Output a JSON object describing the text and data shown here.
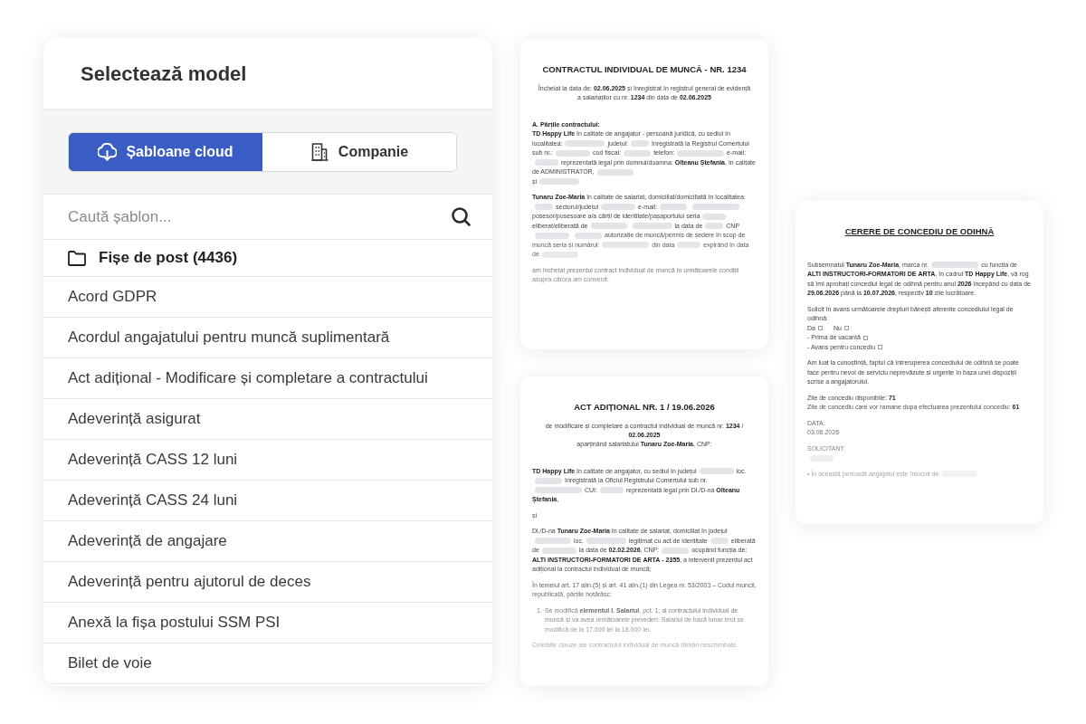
{
  "panel": {
    "title": "Selectează model",
    "tabs": [
      {
        "label": "Șabloane cloud",
        "selected": true
      },
      {
        "label": "Companie",
        "selected": false
      }
    ],
    "search": {
      "placeholder": "Caută șablon..."
    },
    "folder": {
      "label": "Fișe de post (4436)"
    },
    "templates": [
      "Acord GDPR",
      "Acordul angajatului pentru muncă suplimentară",
      "Act adițional - Modificare și completare a contractului",
      "Adeverință asigurat",
      "Adeverință CASS 12 luni",
      "Adeverință CASS 24 luni",
      "Adeverință de angajare",
      "Adeverință pentru ajutorul de deces",
      "Anexă la fișa postului SSM PSI",
      "Bilet de voie"
    ]
  },
  "documents": [
    {
      "title": "CONTRACTUL INDIVIDUAL DE MUNCĂ - NR. 1234",
      "title_underlined": false,
      "blocks": [
        {
          "kind": "centered",
          "lines": [
            [
              {
                "kind": "text",
                "text": "Încheiat la data de: **02.06.2025** și înregistrat în registrul general de evidență"
              }
            ],
            [
              {
                "kind": "text",
                "text": "a salariaților cu nr. **1234** din data de **02.06.2025**"
              }
            ]
          ]
        },
        {
          "kind": "plain",
          "lines": [
            [
              {
                "kind": "text",
                "text": "**A. Părțile contractului:**"
              }
            ],
            [
              {
                "kind": "text",
                "text": "**TD Happy Life** în calitate de angajator - persoană juridică, cu sediul în localitatea:"
              },
              {
                "kind": "blank"
              },
              {
                "kind": "text",
                "text": "județul:"
              },
              {
                "kind": "blank"
              },
              {
                "kind": "text",
                "text": "înregistrată la Registrul Comerțului sub nr.:"
              },
              {
                "kind": "blank"
              },
              {
                "kind": "text",
                "text": "cod fiscal:"
              },
              {
                "kind": "blank"
              },
              {
                "kind": "text",
                "text": "telefon:"
              },
              {
                "kind": "blank"
              },
              {
                "kind": "text",
                "text": "e-mail:"
              },
              {
                "kind": "blank"
              },
              {
                "kind": "text",
                "text": "reprezentată legal prin domnul/doamna: **Olteanu Ștefania**, în calitate de ADMINISTRATOR,"
              },
              {
                "kind": "blank"
              }
            ],
            [
              {
                "kind": "text",
                "text": "și"
              },
              {
                "kind": "blank"
              }
            ]
          ]
        },
        {
          "kind": "plain",
          "lines": [
            [
              {
                "kind": "text",
                "text": "**Tunaru Zoe-Maria** în calitate de salariat, domiciliat/domiciliată în localitatea:"
              },
              {
                "kind": "blank"
              },
              {
                "kind": "text",
                "text": "sectorul/județul"
              },
              {
                "kind": "blank"
              },
              {
                "kind": "text",
                "text": "e-mail:"
              },
              {
                "kind": "blank"
              },
              {
                "kind": "blank"
              },
              {
                "kind": "text",
                "text": "posesor/posesoare a/a cărții de identitate/pașaportului seria"
              },
              {
                "kind": "blank"
              },
              {
                "kind": "text",
                "text": "eliberat/eliberată de"
              },
              {
                "kind": "blank"
              },
              {
                "kind": "blank"
              },
              {
                "kind": "text",
                "text": "la data de"
              },
              {
                "kind": "blank"
              },
              {
                "kind": "text",
                "text": "CNP"
              },
              {
                "kind": "blank"
              },
              {
                "kind": "blank"
              },
              {
                "kind": "text",
                "text": "autorizație de muncă/permis de ședere în scop de muncă seria și numărul:"
              },
              {
                "kind": "blank"
              },
              {
                "kind": "text",
                "text": "din data"
              },
              {
                "kind": "blank"
              },
              {
                "kind": "text",
                "text": "expirând în data de"
              },
              {
                "kind": "blank"
              }
            ]
          ]
        },
        {
          "kind": "plain",
          "lines": [
            [
              {
                "kind": "text",
                "text": "am încheiat prezentul contract individual de muncă în următoarele condiții asupra cărora am convenit:"
              }
            ]
          ]
        }
      ]
    },
    {
      "title": "ACT ADIȚIONAL NR. 1 / 19.06.2026",
      "title_underlined": false,
      "blocks": [
        {
          "kind": "centered",
          "lines": [
            [
              {
                "kind": "text",
                "text": "de modificare și completare a contractul individual de muncă nr. **1234** / **02.06.2025**"
              }
            ],
            [
              {
                "kind": "text",
                "text": "aparținând salariatului **Tunaru Zoe-Maria**, CNP:"
              }
            ]
          ]
        },
        {
          "kind": "plain",
          "lines": [
            [
              {
                "kind": "text",
                "text": "**TD Happy Life** în calitate de angajator, cu sediul în județul"
              },
              {
                "kind": "blank"
              },
              {
                "kind": "text",
                "text": "loc."
              },
              {
                "kind": "blank"
              },
              {
                "kind": "text",
                "text": "înregistrată la Oficiul Registrului Comerțului sub nr."
              },
              {
                "kind": "blank"
              },
              {
                "kind": "text",
                "text": "CUI:"
              },
              {
                "kind": "blank"
              },
              {
                "kind": "text",
                "text": "reprezentată legal prin Dl./D-na **Olteanu Ștefania**,"
              }
            ]
          ]
        },
        {
          "kind": "plain",
          "lines": [
            [
              {
                "kind": "text",
                "text": "și"
              }
            ]
          ]
        },
        {
          "kind": "plain",
          "lines": [
            [
              {
                "kind": "text",
                "text": "Dl./D-na **Tunaru Zoe-Maria** în calitate de salariat, domiciliat în județul"
              },
              {
                "kind": "blank"
              },
              {
                "kind": "text",
                "text": "loc."
              },
              {
                "kind": "blank"
              },
              {
                "kind": "text",
                "text": "legitimat cu act de identitate"
              },
              {
                "kind": "blank"
              },
              {
                "kind": "text",
                "text": "eliberată de"
              },
              {
                "kind": "blank"
              },
              {
                "kind": "text",
                "text": "la data de **02.02.2026**, CNP:"
              },
              {
                "kind": "blank"
              },
              {
                "kind": "text",
                "text": "ocupând funcția de: **ALTI INSTRUCTORI-FORMATORI DE ARTA - 2355**, a intervenit prezentul act adițional la contractul individual de muncă;"
              }
            ]
          ]
        },
        {
          "kind": "plain",
          "lines": [
            [
              {
                "kind": "text",
                "text": "În temeiul art. 17 alin.(5) și art. 41 alin.(1) din Legea nr. 53/2003 – Codul muncii, republicată, părțile hotărăsc:"
              }
            ]
          ]
        },
        {
          "kind": "numbered",
          "number": "1.",
          "lines": [
            [
              {
                "kind": "text",
                "text": "Se modifică **elementul I. Salariul**, pct. 1; al contractului individual de muncă și va avea următoarele prevederi: Salariul de bază lunar brut se modifică de la 17.000 lei la 18.000 lei."
              }
            ]
          ]
        },
        {
          "kind": "plain",
          "lines": [
            [
              {
                "kind": "text",
                "text": "Celelalte clauze ale contractului individual de muncă rămân neschimbate."
              }
            ]
          ]
        }
      ]
    },
    {
      "title": "CERERE DE CONCEDIU DE ODIHNĂ",
      "title_underlined": true,
      "blocks": [
        {
          "kind": "plain",
          "lines": [
            [
              {
                "kind": "text",
                "text": "Subsemnatul **Tunaru Zoe-Maria**, marca nr."
              },
              {
                "kind": "blank"
              },
              {
                "kind": "text",
                "text": "cu funcția de **ALTI INSTRUCTORI-FORMATORI DE ARTA**, în cadrul **TD Happy Life**, vă rog să îmi aprobați concediul legal de odihnă pentru anul **2026** începând cu data de **29.06.2026** până la **10.07.2026**, respectiv **10** zile lucrătoare."
              }
            ]
          ]
        },
        {
          "kind": "plain",
          "lines": [
            [
              {
                "kind": "text",
                "text": "Solicit în avans următoarele drepturi bănești aferente concediului legal de odihnă:"
              }
            ],
            [
              {
                "kind": "text",
                "text": "Da"
              },
              {
                "kind": "checkbox",
                "checked": false
              },
              {
                "kind": "text",
                "text": "Nu"
              },
              {
                "kind": "checkbox",
                "checked": false
              }
            ],
            [
              {
                "kind": "text",
                "text": "- Prima de vacanță"
              },
              {
                "kind": "checkbox",
                "checked": false
              }
            ],
            [
              {
                "kind": "text",
                "text": "- Avans pentru concediu"
              },
              {
                "kind": "checkbox",
                "checked": false
              }
            ]
          ]
        },
        {
          "kind": "plain",
          "lines": [
            [
              {
                "kind": "text",
                "text": "Am luat la cunoștință, faptul că întreruperea concediului de odihnă se poate face pentru nevoi de serviciu neprevăzute și urgente în baza unei dispoziții scrise a angajatorului."
              }
            ]
          ]
        },
        {
          "kind": "plain",
          "lines": [
            [
              {
                "kind": "text",
                "text": "Zile de concediu disponibile: **71**"
              }
            ],
            [
              {
                "kind": "text",
                "text": "Zile de concediu care vor ramane dupa efectuarea prezentului concediu: **61**"
              }
            ]
          ]
        },
        {
          "kind": "plain",
          "lines": [
            [
              {
                "kind": "text",
                "text": "DATA:"
              }
            ],
            [
              {
                "kind": "text",
                "text": "03.06.2026"
              }
            ]
          ]
        },
        {
          "kind": "plain",
          "lines": [
            [
              {
                "kind": "text",
                "text": "SOLICITANT:"
              }
            ],
            [
              {
                "kind": "blank"
              }
            ]
          ]
        },
        {
          "kind": "plain",
          "lines": [
            [
              {
                "kind": "text",
                "text": "• În această perioadă angajatul este înlocuit de"
              },
              {
                "kind": "blank"
              }
            ]
          ]
        }
      ]
    }
  ]
}
